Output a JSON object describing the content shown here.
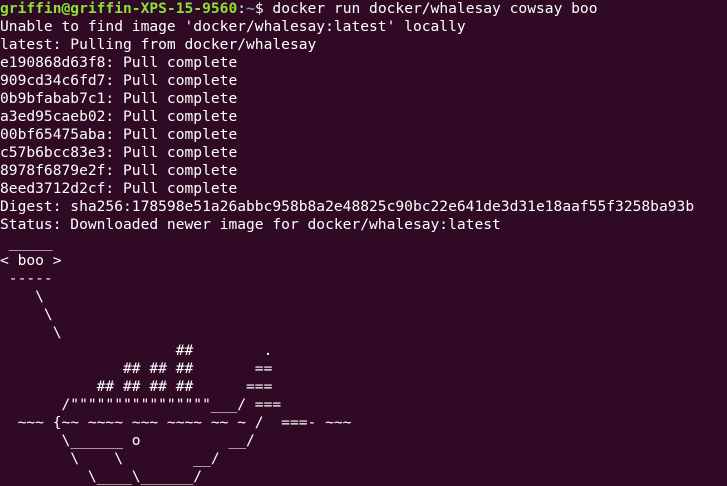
{
  "prompt": {
    "user_host": "griffin@griffin-XPS-15-9560",
    "separator": ":",
    "path": "~",
    "symbol": "$ ",
    "command": "docker run docker/whalesay cowsay boo"
  },
  "output_lines": [
    "Unable to find image 'docker/whalesay:latest' locally",
    "latest: Pulling from docker/whalesay",
    "e190868d63f8: Pull complete",
    "909cd34c6fd7: Pull complete",
    "0b9bfabab7c1: Pull complete",
    "a3ed95caeb02: Pull complete",
    "00bf65475aba: Pull complete",
    "c57b6bcc83e3: Pull complete",
    "8978f6879e2f: Pull complete",
    "8eed3712d2cf: Pull complete",
    "Digest: sha256:178598e51a26abbc958b8a2e48825c90bc22e641de3d31e18aaf55f3258ba93b",
    "Status: Downloaded newer image for docker/whalesay:latest"
  ],
  "cowsay_art": [
    " _____",
    "< boo >",
    " -----",
    "    \\",
    "     \\",
    "      \\",
    "                    ##        .",
    "              ## ## ##       ==",
    "           ## ## ## ##      ===",
    "       /\"\"\"\"\"\"\"\"\"\"\"\"\"\"\"\"___/ ===",
    "  ~~~ {~~ ~~~~ ~~~ ~~~~ ~~ ~ /  ===- ~~~",
    "       \\______ o          __/",
    "        \\    \\        __/",
    "          \\____\\______/"
  ],
  "colors": {
    "background": "#300a24",
    "foreground": "#ffffff",
    "prompt_user": "#8ae234",
    "prompt_path": "#729fcf"
  }
}
